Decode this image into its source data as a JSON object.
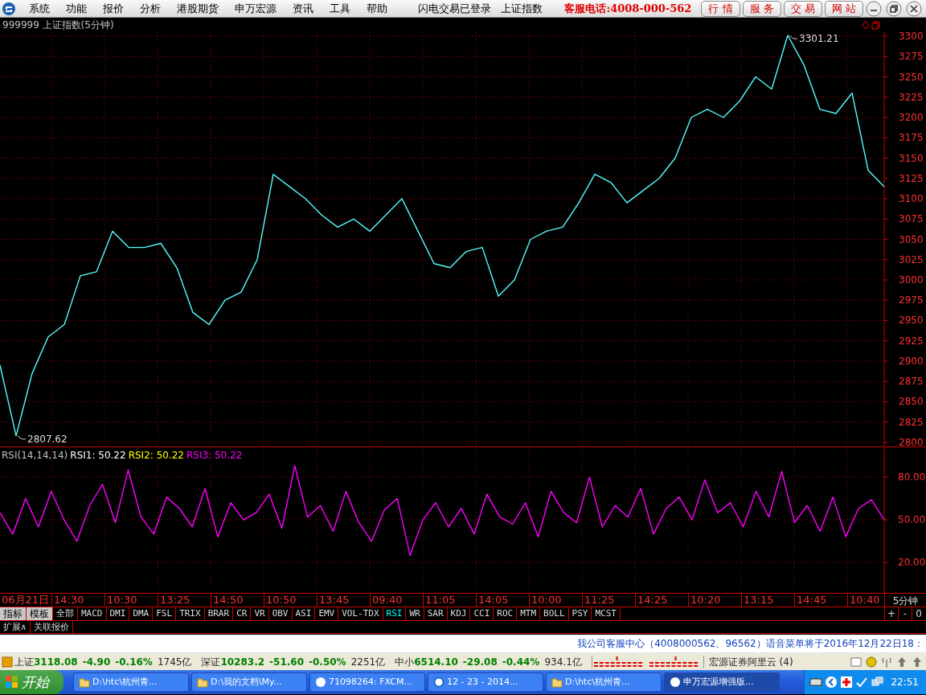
{
  "menu": {
    "items": [
      "系统",
      "功能",
      "报价",
      "分析",
      "港股期货",
      "申万宏源",
      "资讯",
      "工具",
      "帮助"
    ],
    "status": [
      "闪电交易已登录",
      "上证指数"
    ],
    "hotline": "客服电话:4008-000-562",
    "buttons": [
      "行 情",
      "服 务",
      "交 易",
      "网 站"
    ]
  },
  "chart_title": "999999 上证指数(5分钟)",
  "price_chart": {
    "chart_data": {
      "type": "line",
      "grid": true,
      "yticks": [
        2800,
        2825,
        2850,
        2875,
        2900,
        2925,
        2950,
        2975,
        3000,
        3025,
        3050,
        3075,
        3100,
        3125,
        3150,
        3175,
        3200,
        3225,
        3250,
        3275,
        3300
      ],
      "ylim": [
        2795,
        3305
      ],
      "series": [
        {
          "color": "#54fcfc",
          "values": [
            2895,
            2808,
            2885,
            2930,
            2945,
            3005,
            3010,
            3060,
            3040,
            3040,
            3045,
            3015,
            2960,
            2945,
            2975,
            2985,
            3025,
            3130,
            3115,
            3100,
            3080,
            3065,
            3075,
            3060,
            3080,
            3100,
            3060,
            3020,
            3015,
            3035,
            3040,
            2980,
            3000,
            3050,
            3060,
            3065,
            3095,
            3130,
            3120,
            3095,
            3110,
            3125,
            3150,
            3200,
            3210,
            3200,
            3220,
            3250,
            3235,
            3301,
            3265,
            3210,
            3205,
            3230,
            3135,
            3115
          ]
        }
      ],
      "annotations": [
        "3301.21",
        "2807.62"
      ]
    }
  },
  "rsi_panel": {
    "legend": [
      {
        "text": "RSI(14,14,14)",
        "color": "#c0c0c0"
      },
      {
        "text": "RSI1: 50.22",
        "color": "#ffffff"
      },
      {
        "text": "RSI2: 50.22",
        "color": "#ffff00"
      },
      {
        "text": "RSI3: 50.22",
        "color": "#ff00ff"
      }
    ],
    "chart_data": {
      "type": "line",
      "grid": true,
      "ylim": [
        0,
        100
      ],
      "yticks": [
        {
          "value": 80,
          "label": "80.00"
        },
        {
          "value": 50,
          "label": "50.00"
        },
        {
          "value": 20,
          "label": "20.00"
        }
      ],
      "series": [
        {
          "color": "#ff00ff",
          "values": [
            55,
            40,
            65,
            45,
            70,
            50,
            35,
            60,
            75,
            48,
            85,
            52,
            40,
            66,
            58,
            45,
            72,
            38,
            62,
            50,
            55,
            68,
            44,
            88,
            52,
            60,
            42,
            70,
            48,
            35,
            57,
            65,
            25,
            50,
            62,
            45,
            58,
            40,
            68,
            52,
            47,
            62,
            38,
            70,
            55,
            48,
            80,
            45,
            60,
            52,
            72,
            40,
            58,
            66,
            50,
            78,
            55,
            62,
            45,
            70,
            52,
            84,
            48,
            60,
            42,
            66,
            38,
            58,
            64,
            50
          ]
        }
      ]
    }
  },
  "time_axis": [
    "06月21日",
    "14:30",
    "10:30",
    "13:25",
    "14:50",
    "10:50",
    "13:45",
    "09:40",
    "11:05",
    "14:05",
    "10:00",
    "11:25",
    "14:25",
    "10:20",
    "13:15",
    "14:45",
    "10:40"
  ],
  "period": "5分钟",
  "indicator_tabs": [
    {
      "label": "指标",
      "kind": "panel",
      "selected": false
    },
    {
      "label": "模板",
      "kind": "panel",
      "selected": false
    },
    {
      "label": "全部",
      "kind": "indicator",
      "selected": false
    },
    {
      "label": "MACD",
      "kind": "indicator",
      "selected": false
    },
    {
      "label": "DMI",
      "kind": "indicator",
      "selected": false
    },
    {
      "label": "DMA",
      "kind": "indicator",
      "selected": false
    },
    {
      "label": "FSL",
      "kind": "indicator",
      "selected": false
    },
    {
      "label": "TRIX",
      "kind": "indicator",
      "selected": false
    },
    {
      "label": "BRAR",
      "kind": "indicator",
      "selected": false
    },
    {
      "label": "CR",
      "kind": "indicator",
      "selected": false
    },
    {
      "label": "VR",
      "kind": "indicator",
      "selected": false
    },
    {
      "label": "OBV",
      "kind": "indicator",
      "selected": false
    },
    {
      "label": "ASI",
      "kind": "indicator",
      "selected": false
    },
    {
      "label": "EMV",
      "kind": "indicator",
      "selected": false
    },
    {
      "label": "VOL-TDX",
      "kind": "indicator",
      "selected": false
    },
    {
      "label": "RSI",
      "kind": "indicator",
      "selected": true
    },
    {
      "label": "WR",
      "kind": "indicator",
      "selected": false
    },
    {
      "label": "SAR",
      "kind": "indicator",
      "selected": false
    },
    {
      "label": "KDJ",
      "kind": "indicator",
      "selected": false
    },
    {
      "label": "CCI",
      "kind": "indicator",
      "selected": false
    },
    {
      "label": "ROC",
      "kind": "indicator",
      "selected": false
    },
    {
      "label": "MTM",
      "kind": "indicator",
      "selected": false
    },
    {
      "label": "BOLL",
      "kind": "indicator",
      "selected": false
    },
    {
      "label": "PSY",
      "kind": "indicator",
      "selected": false
    },
    {
      "label": "MCST",
      "kind": "indicator",
      "selected": false
    }
  ],
  "zoom_buttons": [
    "+",
    "-",
    "0"
  ],
  "extra_tabs": [
    "扩展∧",
    "关联报价"
  ],
  "notice": "我公司客服中心（4008000562、96562）语音菜单将于2016年12月22日18：",
  "quotes": [
    {
      "name": "上证",
      "price": "3118.08",
      "change": "-4.90",
      "percent": "-0.16%",
      "amount": "1745亿"
    },
    {
      "name": "深证",
      "price": "10283.2",
      "change": "-51.60",
      "percent": "-0.50%",
      "amount": "2251亿"
    },
    {
      "name": "中小",
      "price": "6514.10",
      "change": "-29.08",
      "percent": "-0.44%",
      "amount": "934.1亿"
    }
  ],
  "server": "宏源证券阿里云 (4)",
  "taskbar": {
    "start": "开始",
    "tasks": [
      {
        "label": "D:\\htc\\杭州青...",
        "kind": "folder",
        "selected": false
      },
      {
        "label": "D:\\我的文档\\My...",
        "kind": "folder",
        "selected": false
      },
      {
        "label": "71098264: FXCM...",
        "kind": "app",
        "selected": false
      },
      {
        "label": "12 - 23 - 2014...",
        "kind": "browser",
        "selected": false
      },
      {
        "label": "D:\\htc\\杭州青...",
        "kind": "folder",
        "selected": false
      },
      {
        "label": "申万宏源增强版...",
        "kind": "app",
        "selected": true
      }
    ],
    "clock": "22:51"
  }
}
